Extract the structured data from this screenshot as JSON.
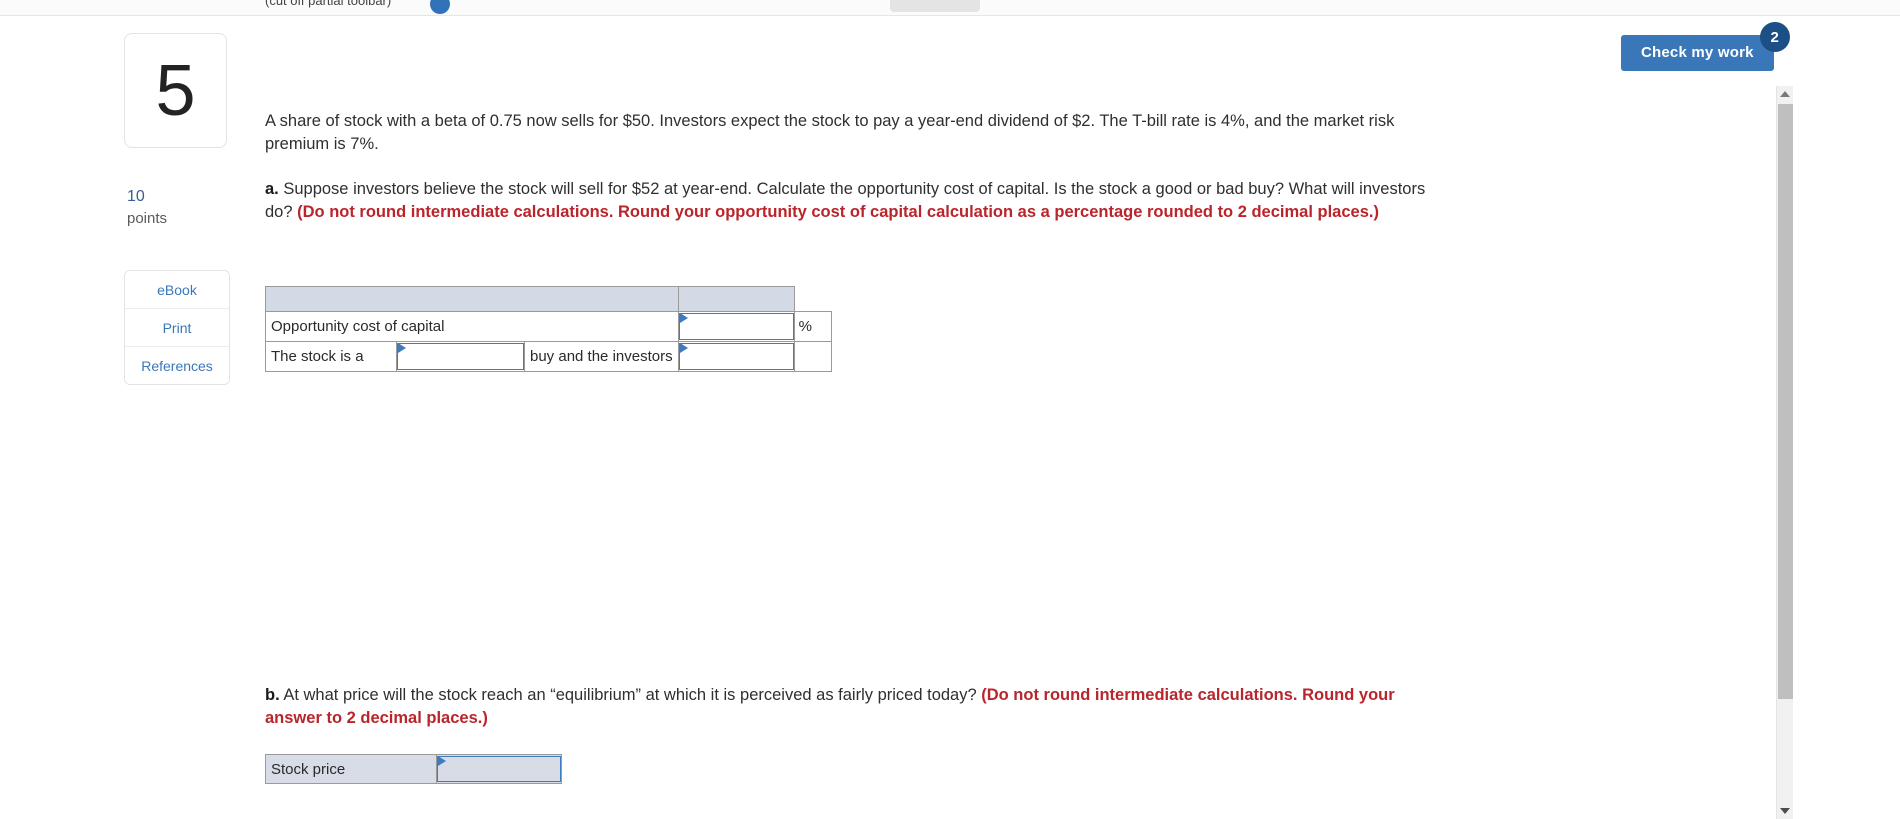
{
  "topbar": {
    "crumb": "(cut off partial toolbar)",
    "right_label": ""
  },
  "check": {
    "label": "Check my work",
    "badge": "2"
  },
  "rail": {
    "question_number": "5",
    "points_value": "10",
    "points_label": "points",
    "items": [
      {
        "label": "eBook"
      },
      {
        "label": "Print"
      },
      {
        "label": "References"
      }
    ]
  },
  "question": {
    "intro": "A share of stock with a beta of 0.75 now sells for $50. Investors expect the stock to pay a year-end dividend of $2. The T-bill rate is 4%, and the market risk premium is 7%.",
    "part_a": {
      "letter": "a.",
      "text": " Suppose investors believe the stock will sell for $52 at year-end. Calculate the opportunity cost of capital. Is the stock a good or bad buy? What will investors do? ",
      "red": "(Do not round intermediate calculations. Round your opportunity cost of capital calculation as a percentage rounded to 2 decimal places.)"
    },
    "part_b": {
      "letter": "b.",
      "text": " At what price will the stock reach an “equilibrium” at which it is perceived as fairly priced today? ",
      "red": "(Do not round intermediate calculations. Round your answer to 2 decimal places.)"
    }
  },
  "table_a": {
    "row1_label": "Opportunity cost of capital",
    "row1_value": "",
    "row1_unit": "%",
    "row2_label_left": "The stock is a",
    "row2_select1": "",
    "row2_label_mid": "buy and the investors",
    "row2_select2": ""
  },
  "table_b": {
    "label": "Stock price",
    "value": ""
  },
  "colors": {
    "accent_blue": "#3a77b8",
    "badge_blue": "#1c4f86",
    "red": "#b9252b",
    "header_fill": "#d4dae5",
    "field_border": "#3e7cc0"
  }
}
